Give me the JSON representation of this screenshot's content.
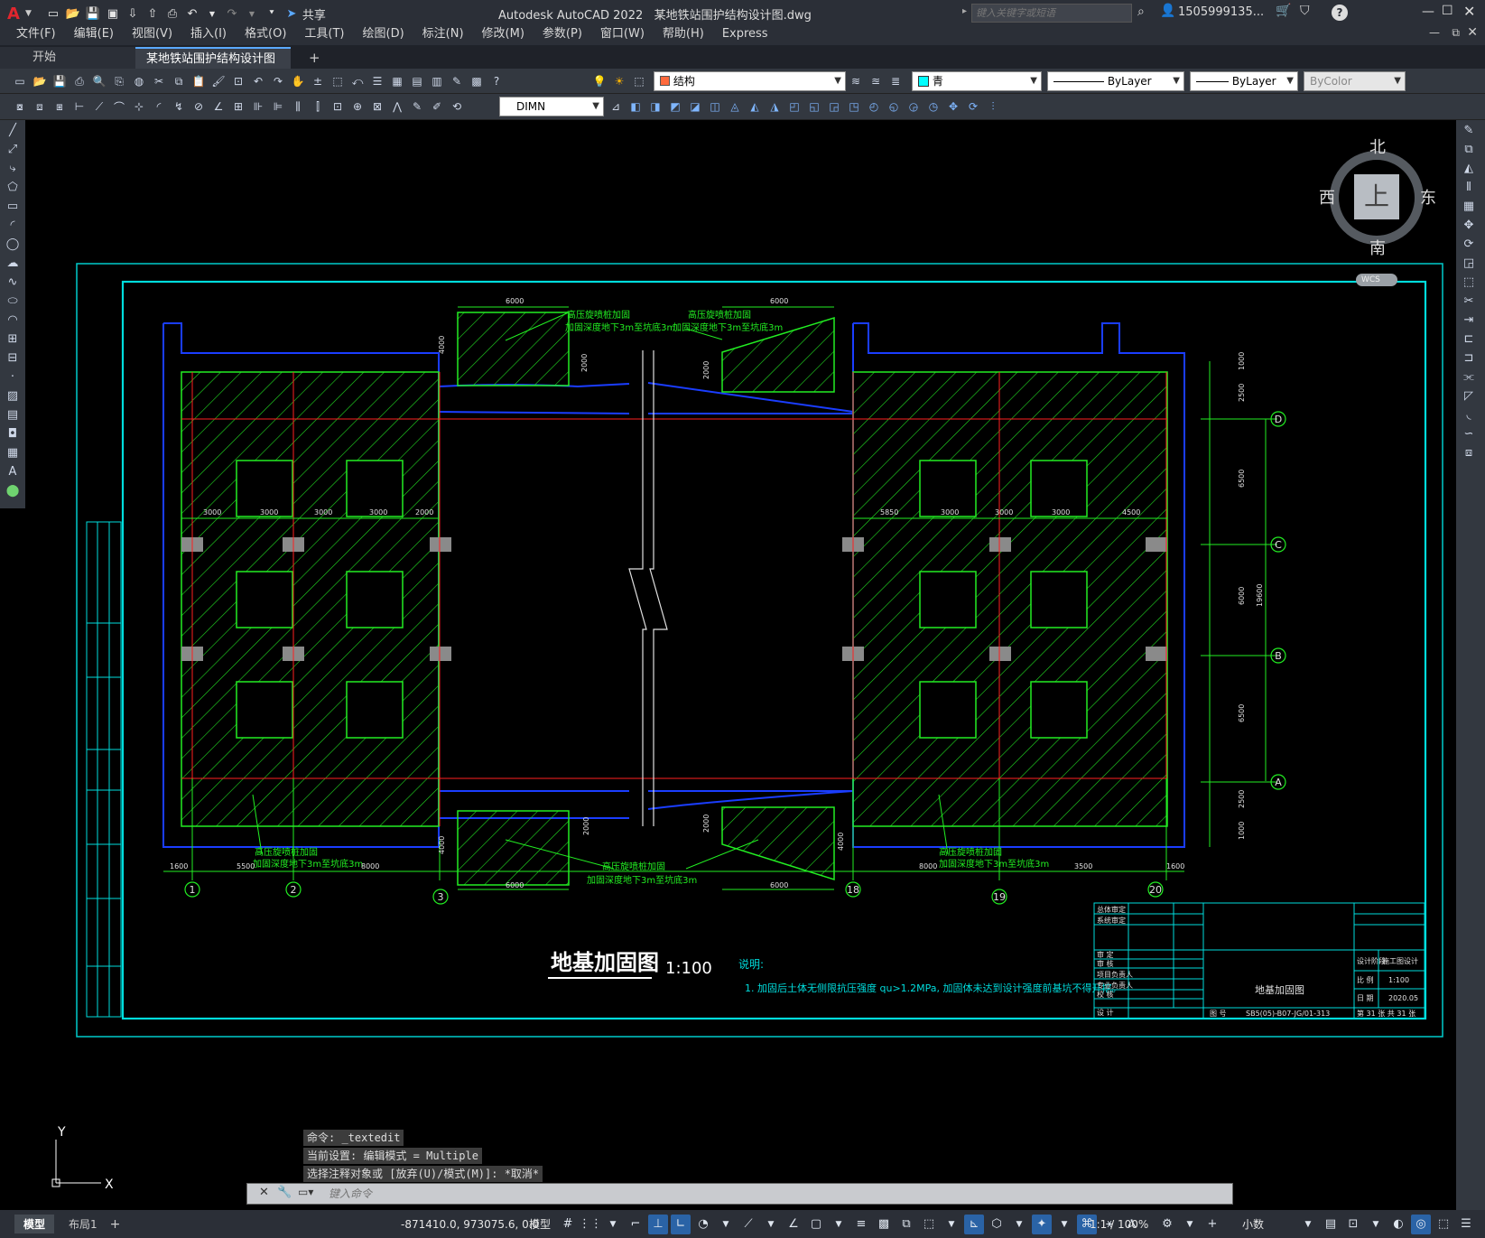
{
  "titlebar": {
    "app_logo": "A",
    "app_name": "Autodesk AutoCAD 2022",
    "file_name": "某地铁站围护结构设计图.dwg",
    "share_label": "共享",
    "search_placeholder": "键入关键字或短语",
    "user": "1505999135...",
    "help": "?"
  },
  "menus": [
    "文件(F)",
    "编辑(E)",
    "视图(V)",
    "插入(I)",
    "格式(O)",
    "工具(T)",
    "绘图(D)",
    "标注(N)",
    "修改(M)",
    "参数(P)",
    "窗口(W)",
    "帮助(H)",
    "Express"
  ],
  "tabs": {
    "start": "开始",
    "active": "某地铁站围护结构设计图*"
  },
  "toolbar": {
    "layer": "结构",
    "color": "青",
    "linetype": "ByLayer",
    "lineweight": "ByLayer",
    "plotstyle": "ByColor",
    "dimstyle": "DIMN"
  },
  "viewcube": {
    "north": "北",
    "south": "南",
    "east": "东",
    "west": "西",
    "face": "上",
    "wcs": "WCS"
  },
  "drawing": {
    "title": "地基加固图",
    "scale": "1:100",
    "note_head": "说明:",
    "note_text": "1. 加固后土体无侧限抗压强度 qu>1.2MPa, 加固体未达到设计强度前基坑不得开挖。",
    "axes_bottom": [
      "1",
      "2",
      "3",
      "18",
      "19",
      "20"
    ],
    "axes_right": [
      "D",
      "C",
      "B",
      "A"
    ],
    "callout_line1": "高压旋喷桩加固",
    "callout_line2": "加固深度地下3m至坑底3m",
    "dims_bottom_left": [
      "1600",
      "5500",
      "8000"
    ],
    "dims_bottom_right": [
      "8000",
      "3500",
      "1600"
    ],
    "dim_6000": "6000",
    "dim_2000": "2000",
    "dim_4000": "4000",
    "dims_row_left": [
      "3000",
      "3000",
      "3000",
      "3000",
      "2000"
    ],
    "dims_row_right": [
      "5850",
      "3000",
      "3000",
      "3000",
      "4500"
    ],
    "dims_right": [
      "1000",
      "2500",
      "6500",
      "6000",
      "6500",
      "2500",
      "1000"
    ],
    "dim_total_right": "19600",
    "tb_drawing_name": "地基加固图",
    "tb_scale_label": "比 例",
    "tb_scale": "1:100",
    "tb_date_label": "日 期",
    "tb_date": "2020.05",
    "tb_stage_label": "设计阶段",
    "tb_stage": "施工图设计",
    "tb_sheet": "第 31 张 共 31 张",
    "tb_no_label": "图 号",
    "tb_no": "SB5(05)-B07-JG/01-313",
    "tb_roles": [
      "总体审定",
      "系统审定",
      "审 定",
      "审 核",
      "项目负责人",
      "专业负责人",
      "校 核",
      "设 计"
    ]
  },
  "commands": {
    "line1": "命令: _textedit",
    "line2": "当前设置: 编辑模式 = Multiple",
    "line3": "选择注释对象或 [放弃(U)/模式(M)]: *取消*",
    "input_placeholder": "键入命令"
  },
  "ucs": {
    "x": "X",
    "y": "Y"
  },
  "status": {
    "model_tab": "模型",
    "layout_tab": "布局1",
    "add_tab": "+",
    "coords": "-871410.0, 973075.6, 0.0",
    "space": "模型",
    "anno_scale": "1:1 / 100%",
    "units": "小数"
  }
}
